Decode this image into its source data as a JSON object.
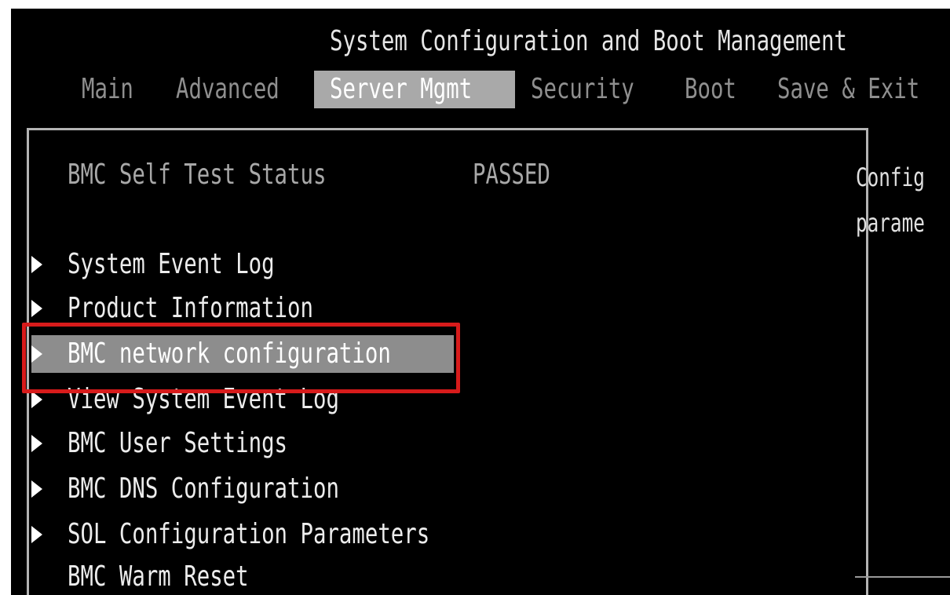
{
  "header": {
    "title": "System Configuration and Boot Management"
  },
  "tabs": [
    {
      "label": "Main",
      "active": false
    },
    {
      "label": "Advanced",
      "active": false
    },
    {
      "label": "Server Mgmt",
      "active": true
    },
    {
      "label": "Security",
      "active": false
    },
    {
      "label": "Boot",
      "active": false
    },
    {
      "label": "Save & Exit",
      "active": false
    }
  ],
  "main": {
    "status": {
      "label": "BMC Self Test Status",
      "value": "PASSED"
    },
    "items": [
      {
        "label": "System Event Log",
        "submenu": true
      },
      {
        "label": "Product Information",
        "submenu": true
      },
      {
        "label": "BMC network configuration",
        "submenu": true,
        "selected": true
      },
      {
        "label": "View System Event Log",
        "submenu": true
      },
      {
        "label": "BMC User Settings",
        "submenu": true
      },
      {
        "label": "BMC DNS Configuration",
        "submenu": true
      },
      {
        "label": "SOL Configuration Parameters",
        "submenu": true
      },
      {
        "label": "BMC Warm Reset",
        "submenu": false
      }
    ]
  },
  "help": {
    "line1": "Config",
    "line2": "parame"
  },
  "colors": {
    "background": "#000000",
    "highlight": "#8d8d8d",
    "active_tab": "#a9a9a9",
    "annotation_box": "#d71b1b"
  }
}
